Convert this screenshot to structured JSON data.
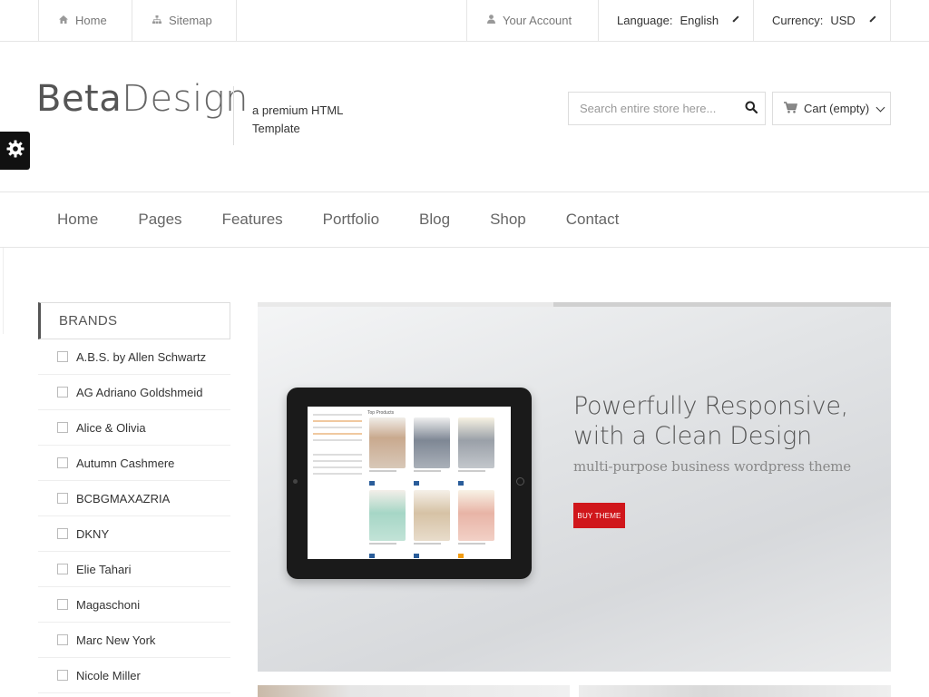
{
  "topbar": {
    "home": "Home",
    "sitemap": "Sitemap",
    "account": "Your Account",
    "language_label": "Language:",
    "language_value": "English",
    "currency_label": "Currency:",
    "currency_value": "USD"
  },
  "header": {
    "logo_bold": "Beta",
    "logo_light": "Design",
    "tagline": "a premium HTML Template",
    "search_placeholder": "Search entire store here...",
    "cart_label": "Cart (empty)"
  },
  "nav": {
    "items": [
      "Home",
      "Pages",
      "Features",
      "Portfolio",
      "Blog",
      "Shop",
      "Contact"
    ]
  },
  "sidebar": {
    "title": "BRANDS",
    "brands": [
      "A.B.S. by Allen Schwartz",
      "AG Adriano Goldshmeid",
      "Alice & Olivia",
      "Autumn Cashmere",
      "BCBGMAXAZRIA",
      "DKNY",
      "Elie Tahari",
      "Magaschoni",
      "Marc New York",
      "Nicole Miller"
    ]
  },
  "slider": {
    "headline_1": "Powerfully Responsive,",
    "headline_2": "with a Clean Design",
    "subline": "multi-purpose business wordpress theme",
    "button": "BUY THEME",
    "screen_title": "Top Products"
  },
  "colors": {
    "accent": "#d0161b",
    "text": "#444444",
    "border": "#e5e5e5"
  }
}
